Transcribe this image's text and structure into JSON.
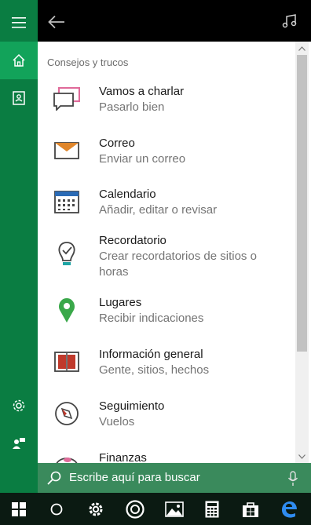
{
  "sidebar": {
    "items": [
      {
        "name": "menu-icon"
      },
      {
        "name": "home-icon",
        "active": true
      },
      {
        "name": "notebook-icon"
      },
      {
        "name": "settings-icon"
      },
      {
        "name": "feedback-icon"
      }
    ]
  },
  "header": {
    "back_icon": "back-arrow-icon",
    "music_icon": "music-note-icon"
  },
  "main": {
    "section_title": "Consejos y trucos",
    "items": [
      {
        "icon": "chat-bubbles-icon",
        "title": "Vamos a charlar",
        "subtitle": "Pasarlo bien"
      },
      {
        "icon": "mail-envelope-icon",
        "title": "Correo",
        "subtitle": "Enviar un correo"
      },
      {
        "icon": "calendar-icon",
        "title": "Calendario",
        "subtitle": "Añadir, editar o revisar"
      },
      {
        "icon": "reminder-bulb-icon",
        "title": "Recordatorio",
        "subtitle": "Crear recordatorios de sitios o horas"
      },
      {
        "icon": "map-pin-icon",
        "title": "Lugares",
        "subtitle": "Recibir indicaciones"
      },
      {
        "icon": "open-book-icon",
        "title": "Información general",
        "subtitle": "Gente, sitios, hechos"
      },
      {
        "icon": "compass-icon",
        "title": "Seguimiento",
        "subtitle": "Vuelos"
      },
      {
        "icon": "piggy-bank-icon",
        "title": "Finanzas",
        "subtitle": ""
      }
    ]
  },
  "search": {
    "placeholder": "Escribe aquí para buscar"
  },
  "taskbar": {
    "items": [
      "windows-start-icon",
      "cortana-circle-icon",
      "settings-gear-icon",
      "groove-music-icon",
      "photos-icon",
      "calculator-icon",
      "store-icon",
      "edge-browser-icon"
    ]
  },
  "colors": {
    "rail": "#0a7d42",
    "rail_active": "#12a35a",
    "search_bar": "#3a8a5c",
    "taskbar": "#0b1a12",
    "icon_pink": "#e06b9a",
    "icon_orange": "#e0862b",
    "icon_blue": "#2b6bb5",
    "icon_teal": "#1fa5a5",
    "icon_green": "#3aa84a",
    "icon_red": "#c0392b"
  }
}
